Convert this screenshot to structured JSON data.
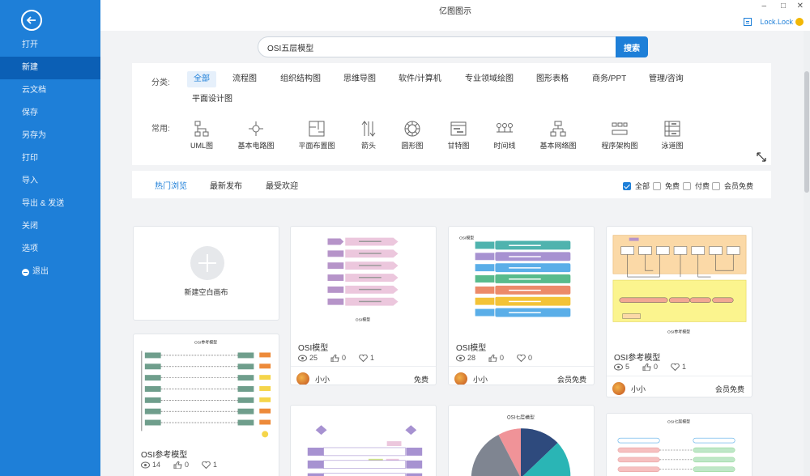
{
  "app": {
    "title": "亿图图示",
    "minimize": "–",
    "maximize": "□",
    "close": "✕",
    "username": "Lock.Lock"
  },
  "sidebar": {
    "items": [
      {
        "label": "打开"
      },
      {
        "label": "新建"
      },
      {
        "label": "云文档"
      },
      {
        "label": "保存"
      },
      {
        "label": "另存为"
      },
      {
        "label": "打印"
      },
      {
        "label": "导入"
      },
      {
        "label": "导出 & 发送"
      },
      {
        "label": "关闭"
      },
      {
        "label": "选项"
      },
      {
        "label": "退出"
      }
    ]
  },
  "search": {
    "value": "OSI五层模型",
    "button": "搜索"
  },
  "categories": {
    "label": "分类:",
    "items": [
      "全部",
      "流程图",
      "组织结构图",
      "思维导图",
      "软件/计算机",
      "专业领域绘图",
      "图形表格",
      "商务/PPT",
      "管理/咨询",
      "平面设计图"
    ]
  },
  "common": {
    "label": "常用:",
    "items": [
      "UML图",
      "基本电路图",
      "平面布置图",
      "箭头",
      "圆形图",
      "甘特图",
      "时间线",
      "基本网络图",
      "程序架构图",
      "泳道图"
    ]
  },
  "sort": {
    "tabs": [
      "热门浏览",
      "最新发布",
      "最受欢迎"
    ],
    "filters": [
      {
        "label": "全部",
        "checked": true
      },
      {
        "label": "免费",
        "checked": false
      },
      {
        "label": "付费",
        "checked": false
      },
      {
        "label": "会员免费",
        "checked": false
      }
    ]
  },
  "new_blank": {
    "label": "新建空白画布"
  },
  "cards": [
    {
      "title": "OSI模型",
      "views": "25",
      "likes": "0",
      "favs": "1",
      "author": "小小",
      "price": "免费",
      "thumb_caption": "OSI模型"
    },
    {
      "title": "OSI模型",
      "views": "28",
      "likes": "0",
      "favs": "0",
      "author": "小小",
      "price": "会员免费",
      "thumb_caption": "OSI模型"
    },
    {
      "title": "OSI参考模型",
      "views": "5",
      "likes": "0",
      "favs": "1",
      "author": "小小",
      "price": "会员免费",
      "thumb_caption": "OSI参考模型"
    },
    {
      "title": "OSI参考模型",
      "views": "14",
      "likes": "0",
      "favs": "1",
      "thumb_caption": "OSI参考模型"
    },
    {
      "thumb_caption": "OSI七层模型"
    },
    {
      "thumb_caption": "OSI七层模型"
    }
  ]
}
